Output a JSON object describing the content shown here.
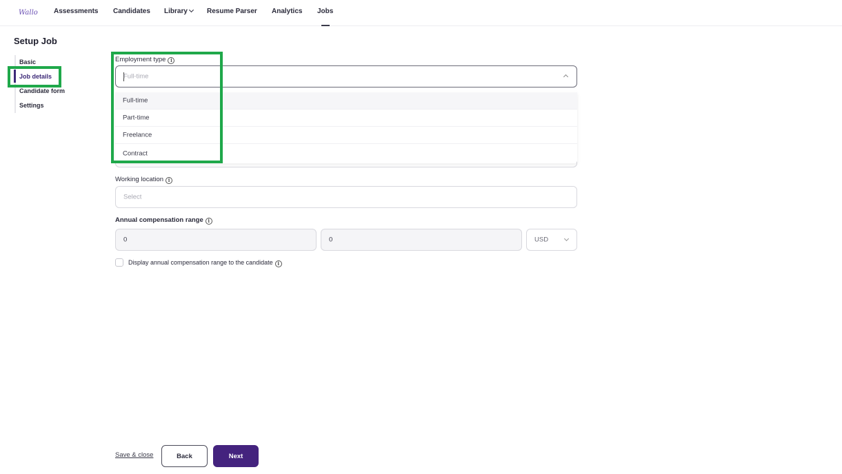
{
  "nav": {
    "logo_text": "Wallo",
    "items": [
      "Assessments",
      "Candidates",
      "Library",
      "Resume Parser",
      "Analytics",
      "Jobs"
    ],
    "active": "Jobs"
  },
  "page": {
    "title": "Setup Job",
    "steps": [
      "Basic",
      "Job details",
      "Candidate form",
      "Settings"
    ],
    "active_step": "Job details"
  },
  "form": {
    "employment_type": {
      "label": "Employment type",
      "placeholder": "Full-time",
      "options": [
        "Full-time",
        "Part-time",
        "Freelance",
        "Contract"
      ]
    },
    "working_location": {
      "label": "Working location",
      "placeholder": "Select"
    },
    "compensation": {
      "label": "Annual compensation range",
      "min": "0",
      "max": "0",
      "currency": "USD"
    },
    "display_checkbox_label": "Display annual compensation range to the candidate"
  },
  "footer": {
    "save_close": "Save & close",
    "back": "Back",
    "next": "Next"
  },
  "colors": {
    "accent": "#44237e",
    "highlight": "#1fa84a"
  }
}
